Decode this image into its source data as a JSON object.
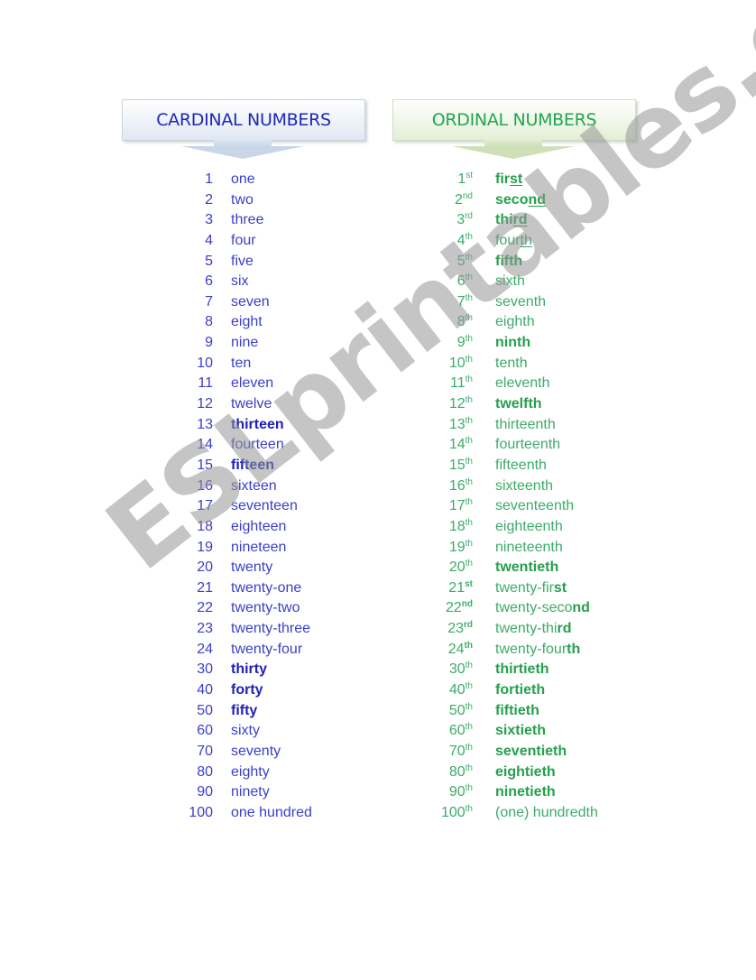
{
  "headers": {
    "cardinal": "CARDINAL NUMBERS",
    "ordinal": "ORDINAL NUMBERS"
  },
  "colors": {
    "cardinal": "#3a3fc8",
    "ordinal": "#3cab6a"
  },
  "watermark": "ESLprintables.com",
  "cardinal": [
    {
      "num": "1",
      "word": "one",
      "bold": false
    },
    {
      "num": "2",
      "word": "two",
      "bold": false
    },
    {
      "num": "3",
      "word": "three",
      "bold": false
    },
    {
      "num": "4",
      "word": "four",
      "bold": false
    },
    {
      "num": "5",
      "word": "five",
      "bold": false
    },
    {
      "num": "6",
      "word": "six",
      "bold": false
    },
    {
      "num": "7",
      "word": "seven",
      "bold": false
    },
    {
      "num": "8",
      "word": "eight",
      "bold": false
    },
    {
      "num": "9",
      "word": "nine",
      "bold": false
    },
    {
      "num": "10",
      "word": "ten",
      "bold": false
    },
    {
      "num": "11",
      "word": "eleven",
      "bold": false
    },
    {
      "num": "12",
      "word": "twelve",
      "bold": false
    },
    {
      "num": "13",
      "word": "thirteen",
      "bold": true
    },
    {
      "num": "14",
      "word": "fourteen",
      "bold": false
    },
    {
      "num": "15",
      "word": "fifteen",
      "bold": true
    },
    {
      "num": "16",
      "word": "sixteen",
      "bold": false
    },
    {
      "num": "17",
      "word": "seventeen",
      "bold": false
    },
    {
      "num": "18",
      "word": "eighteen",
      "bold": false
    },
    {
      "num": "19",
      "word": "nineteen",
      "bold": false
    },
    {
      "num": "20",
      "word": "twenty",
      "bold": false
    },
    {
      "num": "21",
      "word": "twenty-one",
      "bold": false
    },
    {
      "num": "22",
      "word": "twenty-two",
      "bold": false
    },
    {
      "num": "23",
      "word": "twenty-three",
      "bold": false
    },
    {
      "num": "24",
      "word": "twenty-four",
      "bold": false
    },
    {
      "num": "30",
      "word": "thirty",
      "bold": true
    },
    {
      "num": "40",
      "word": "forty",
      "bold": true
    },
    {
      "num": "50",
      "word": "fifty",
      "bold": true
    },
    {
      "num": "60",
      "word": "sixty",
      "bold": false
    },
    {
      "num": "70",
      "word": "seventy",
      "bold": false
    },
    {
      "num": "80",
      "word": "eighty",
      "bold": false
    },
    {
      "num": "90",
      "word": "ninety",
      "bold": false
    },
    {
      "num": "100",
      "word": "one hundred",
      "bold": false
    }
  ],
  "ordinal": [
    {
      "num": "1",
      "suffix": "st",
      "parts": [
        {
          "t": "fir",
          "b": true
        },
        {
          "t": "st",
          "b": true,
          "u": true
        }
      ]
    },
    {
      "num": "2",
      "suffix": "nd",
      "parts": [
        {
          "t": "seco",
          "b": true
        },
        {
          "t": "nd",
          "b": true,
          "u": true
        }
      ]
    },
    {
      "num": "3",
      "suffix": "rd",
      "parts": [
        {
          "t": "thi",
          "b": true
        },
        {
          "t": "rd",
          "b": true,
          "u": true
        }
      ]
    },
    {
      "num": "4",
      "suffix": "th",
      "parts": [
        {
          "t": "four"
        },
        {
          "t": "th",
          "u": true
        }
      ]
    },
    {
      "num": "5",
      "suffix": "th",
      "parts": [
        {
          "t": "fifth",
          "b": true
        }
      ]
    },
    {
      "num": "6",
      "suffix": "th",
      "parts": [
        {
          "t": "sixth"
        }
      ]
    },
    {
      "num": "7",
      "suffix": "th",
      "parts": [
        {
          "t": "seventh"
        }
      ]
    },
    {
      "num": "8",
      "suffix": "th",
      "parts": [
        {
          "t": "eighth"
        }
      ]
    },
    {
      "num": "9",
      "suffix": "th",
      "parts": [
        {
          "t": "ninth",
          "b": true
        }
      ]
    },
    {
      "num": "10",
      "suffix": "th",
      "parts": [
        {
          "t": "tenth"
        }
      ]
    },
    {
      "num": "11",
      "suffix": "th",
      "parts": [
        {
          "t": "eleventh"
        }
      ]
    },
    {
      "num": "12",
      "suffix": "th",
      "parts": [
        {
          "t": "twelfth",
          "b": true
        }
      ]
    },
    {
      "num": "13",
      "suffix": "th",
      "parts": [
        {
          "t": "thirteenth"
        }
      ]
    },
    {
      "num": "14",
      "suffix": "th",
      "parts": [
        {
          "t": "fourteenth"
        }
      ]
    },
    {
      "num": "15",
      "suffix": "th",
      "parts": [
        {
          "t": "fifteenth"
        }
      ]
    },
    {
      "num": "16",
      "suffix": "th",
      "parts": [
        {
          "t": "sixteenth"
        }
      ]
    },
    {
      "num": "17",
      "suffix": "th",
      "parts": [
        {
          "t": "seventeenth"
        }
      ]
    },
    {
      "num": "18",
      "suffix": "th",
      "parts": [
        {
          "t": "eighteenth"
        }
      ]
    },
    {
      "num": "19",
      "suffix": "th",
      "parts": [
        {
          "t": "nineteenth"
        }
      ]
    },
    {
      "num": "20",
      "suffix": "th",
      "parts": [
        {
          "t": "twentieth",
          "b": true
        }
      ]
    },
    {
      "num": "21",
      "suffix": "st",
      "parts": [
        {
          "t": "twenty-fir"
        },
        {
          "t": "st",
          "b": true
        }
      ]
    },
    {
      "num": "22",
      "suffix": "nd",
      "parts": [
        {
          "t": "twenty-seco"
        },
        {
          "t": "nd",
          "b": true
        }
      ]
    },
    {
      "num": "23",
      "suffix": "rd",
      "parts": [
        {
          "t": "twenty-thi"
        },
        {
          "t": "rd",
          "b": true
        }
      ]
    },
    {
      "num": "24",
      "suffix": "th",
      "parts": [
        {
          "t": "twenty-four"
        },
        {
          "t": "th",
          "b": true
        }
      ]
    },
    {
      "num": "30",
      "suffix": "th",
      "parts": [
        {
          "t": "thirtieth",
          "b": true
        }
      ]
    },
    {
      "num": "40",
      "suffix": "th",
      "parts": [
        {
          "t": "fortieth",
          "b": true
        }
      ]
    },
    {
      "num": "50",
      "suffix": "th",
      "parts": [
        {
          "t": "fiftieth",
          "b": true
        }
      ]
    },
    {
      "num": "60",
      "suffix": "th",
      "parts": [
        {
          "t": "sixtieth",
          "b": true
        }
      ]
    },
    {
      "num": "70",
      "suffix": "th",
      "parts": [
        {
          "t": "seventieth",
          "b": true
        }
      ]
    },
    {
      "num": "80",
      "suffix": "th",
      "parts": [
        {
          "t": "eightieth",
          "b": true
        }
      ]
    },
    {
      "num": "90",
      "suffix": "th",
      "parts": [
        {
          "t": "ninetieth",
          "b": true
        }
      ]
    },
    {
      "num": "100",
      "suffix": "th",
      "parts": [
        {
          "t": "(one) hundredth"
        }
      ]
    }
  ]
}
